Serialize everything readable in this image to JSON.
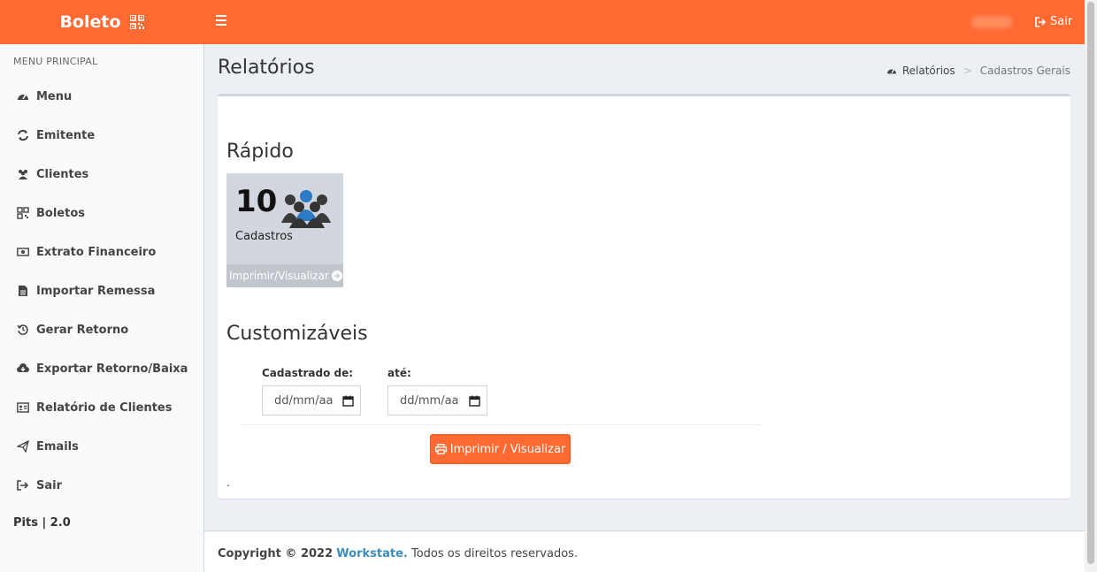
{
  "header": {
    "logo_text": "Boleto",
    "logout_label": "Sair",
    "accent_color": "#ff6a33"
  },
  "sidebar": {
    "header": "MENU PRINCIPAL",
    "items": [
      {
        "label": "Menu",
        "icon": "dashboard-icon"
      },
      {
        "label": "Emitente",
        "icon": "refresh-icon"
      },
      {
        "label": "Clientes",
        "icon": "users-icon"
      },
      {
        "label": "Boletos",
        "icon": "qrcode-icon"
      },
      {
        "label": "Extrato Financeiro",
        "icon": "money-icon"
      },
      {
        "label": "Importar Remessa",
        "icon": "file-icon"
      },
      {
        "label": "Gerar Retorno",
        "icon": "history-icon"
      },
      {
        "label": "Exportar Retorno/Baixa",
        "icon": "cloud-download-icon"
      },
      {
        "label": "Relatório de Clientes",
        "icon": "id-card-icon"
      },
      {
        "label": "Emails",
        "icon": "send-icon"
      },
      {
        "label": "Sair",
        "icon": "sign-out-icon"
      }
    ],
    "version": "Pits | 2.0"
  },
  "page": {
    "title": "Relatórios",
    "breadcrumb": [
      "Relatórios",
      "Cadastros Gerais"
    ]
  },
  "rapido": {
    "title": "Rápido",
    "count": "10",
    "label": "Cadastros",
    "link": "Imprimir/Visualizar"
  },
  "custom": {
    "title": "Customizáveis",
    "from_label": "Cadastrado de:",
    "to_label": "até:",
    "from_placeholder": "dd/mm/aa",
    "to_placeholder": "dd/mm/aa",
    "button": "Imprimir / Visualizar",
    "dot": "."
  },
  "footer": {
    "prefix": "Copyright © 2022",
    "company": "Workstate.",
    "suffix": "Todos os direitos reservados."
  }
}
